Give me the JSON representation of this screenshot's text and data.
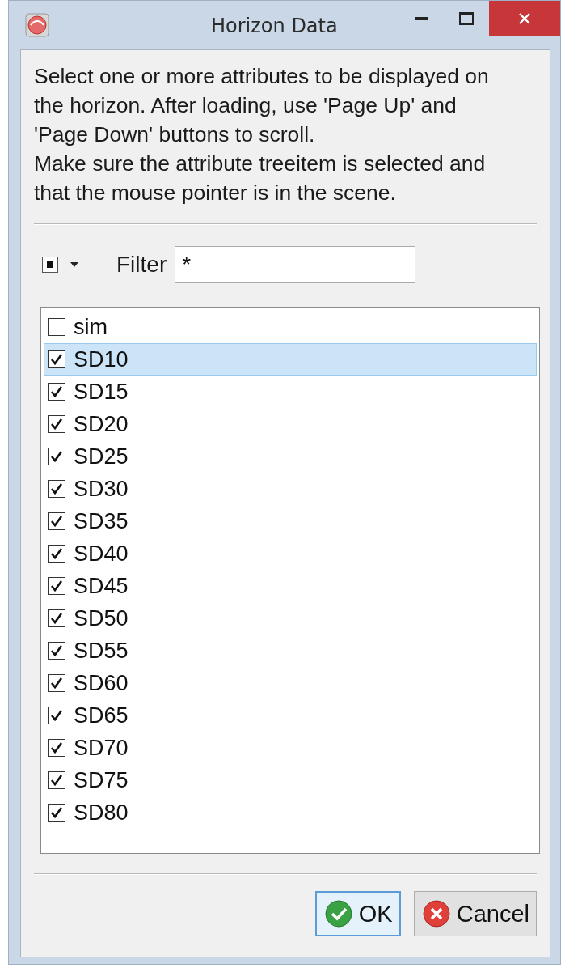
{
  "window": {
    "title": "Horizon Data"
  },
  "instructions": [
    "Select one or more attributes to be displayed on the horizon. After loading, use 'Page Up' and 'Page Down' buttons to scroll.",
    "Make sure the attribute treeitem is selected and that the mouse pointer is in the scene."
  ],
  "select_all": {
    "indeterminate": true
  },
  "filter": {
    "label": "Filter",
    "value": "*"
  },
  "attributes": [
    {
      "label": "sim",
      "checked": false,
      "selected": false
    },
    {
      "label": "SD10",
      "checked": true,
      "selected": true
    },
    {
      "label": "SD15",
      "checked": true,
      "selected": false
    },
    {
      "label": "SD20",
      "checked": true,
      "selected": false
    },
    {
      "label": "SD25",
      "checked": true,
      "selected": false
    },
    {
      "label": "SD30",
      "checked": true,
      "selected": false
    },
    {
      "label": "SD35",
      "checked": true,
      "selected": false
    },
    {
      "label": "SD40",
      "checked": true,
      "selected": false
    },
    {
      "label": "SD45",
      "checked": true,
      "selected": false
    },
    {
      "label": "SD50",
      "checked": true,
      "selected": false
    },
    {
      "label": "SD55",
      "checked": true,
      "selected": false
    },
    {
      "label": "SD60",
      "checked": true,
      "selected": false
    },
    {
      "label": "SD65",
      "checked": true,
      "selected": false
    },
    {
      "label": "SD70",
      "checked": true,
      "selected": false
    },
    {
      "label": "SD75",
      "checked": true,
      "selected": false
    },
    {
      "label": "SD80",
      "checked": true,
      "selected": false
    }
  ],
  "buttons": [
    {
      "label": "OK",
      "kind": "ok",
      "default": true
    },
    {
      "label": "Cancel",
      "kind": "cancel",
      "default": false
    }
  ]
}
